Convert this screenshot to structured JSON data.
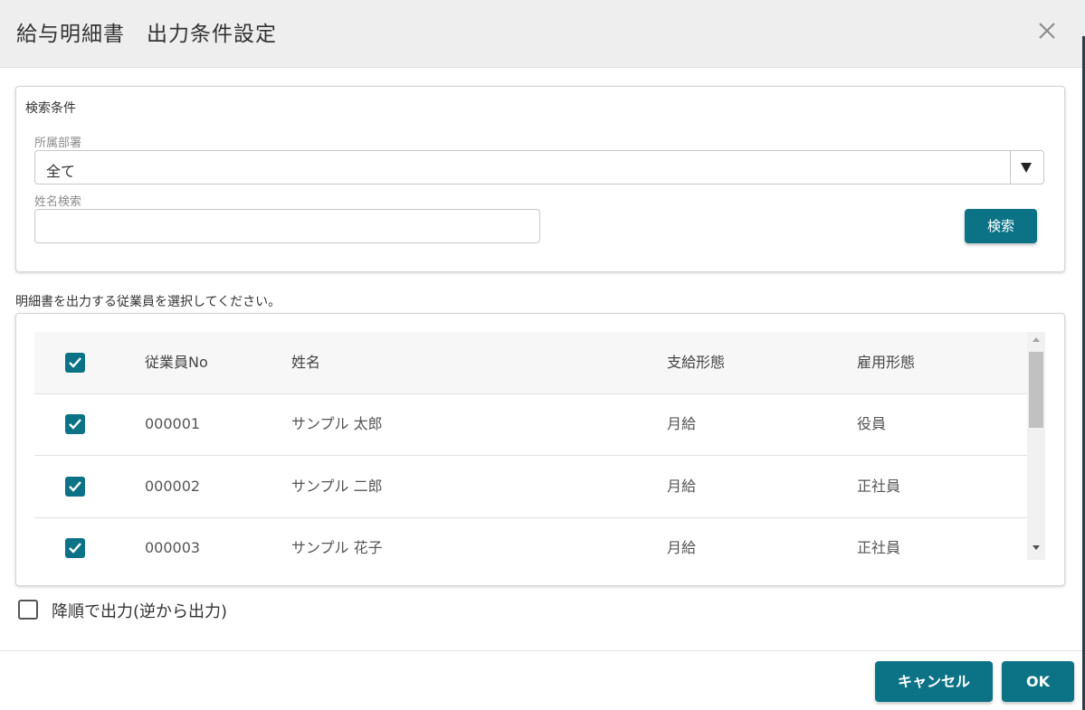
{
  "dialog": {
    "title": "給与明細書　出力条件設定",
    "close_icon": "close-icon"
  },
  "search": {
    "legend": "検索条件",
    "department_label": "所属部署",
    "department_value": "全て",
    "name_label": "姓名検索",
    "name_value": "",
    "search_button": "検索"
  },
  "employees": {
    "instruction": "明細書を出力する従業員を選択してください。",
    "header": {
      "checked": true,
      "no": "従業員No",
      "name": "姓名",
      "pay_type": "支給形態",
      "employment_type": "雇用形態"
    },
    "rows": [
      {
        "checked": true,
        "no": "000001",
        "name": "サンプル 太郎",
        "pay_type": "月給",
        "employment_type": "役員"
      },
      {
        "checked": true,
        "no": "000002",
        "name": "サンプル 二郎",
        "pay_type": "月給",
        "employment_type": "正社員"
      },
      {
        "checked": true,
        "no": "000003",
        "name": "サンプル 花子",
        "pay_type": "月給",
        "employment_type": "正社員"
      }
    ]
  },
  "options": {
    "descending_label": "降順で出力(逆から出力)",
    "descending_checked": false
  },
  "footer": {
    "cancel": "キャンセル",
    "ok": "OK"
  },
  "colors": {
    "accent": "#0c7386",
    "header_bg": "#eeeeee"
  }
}
